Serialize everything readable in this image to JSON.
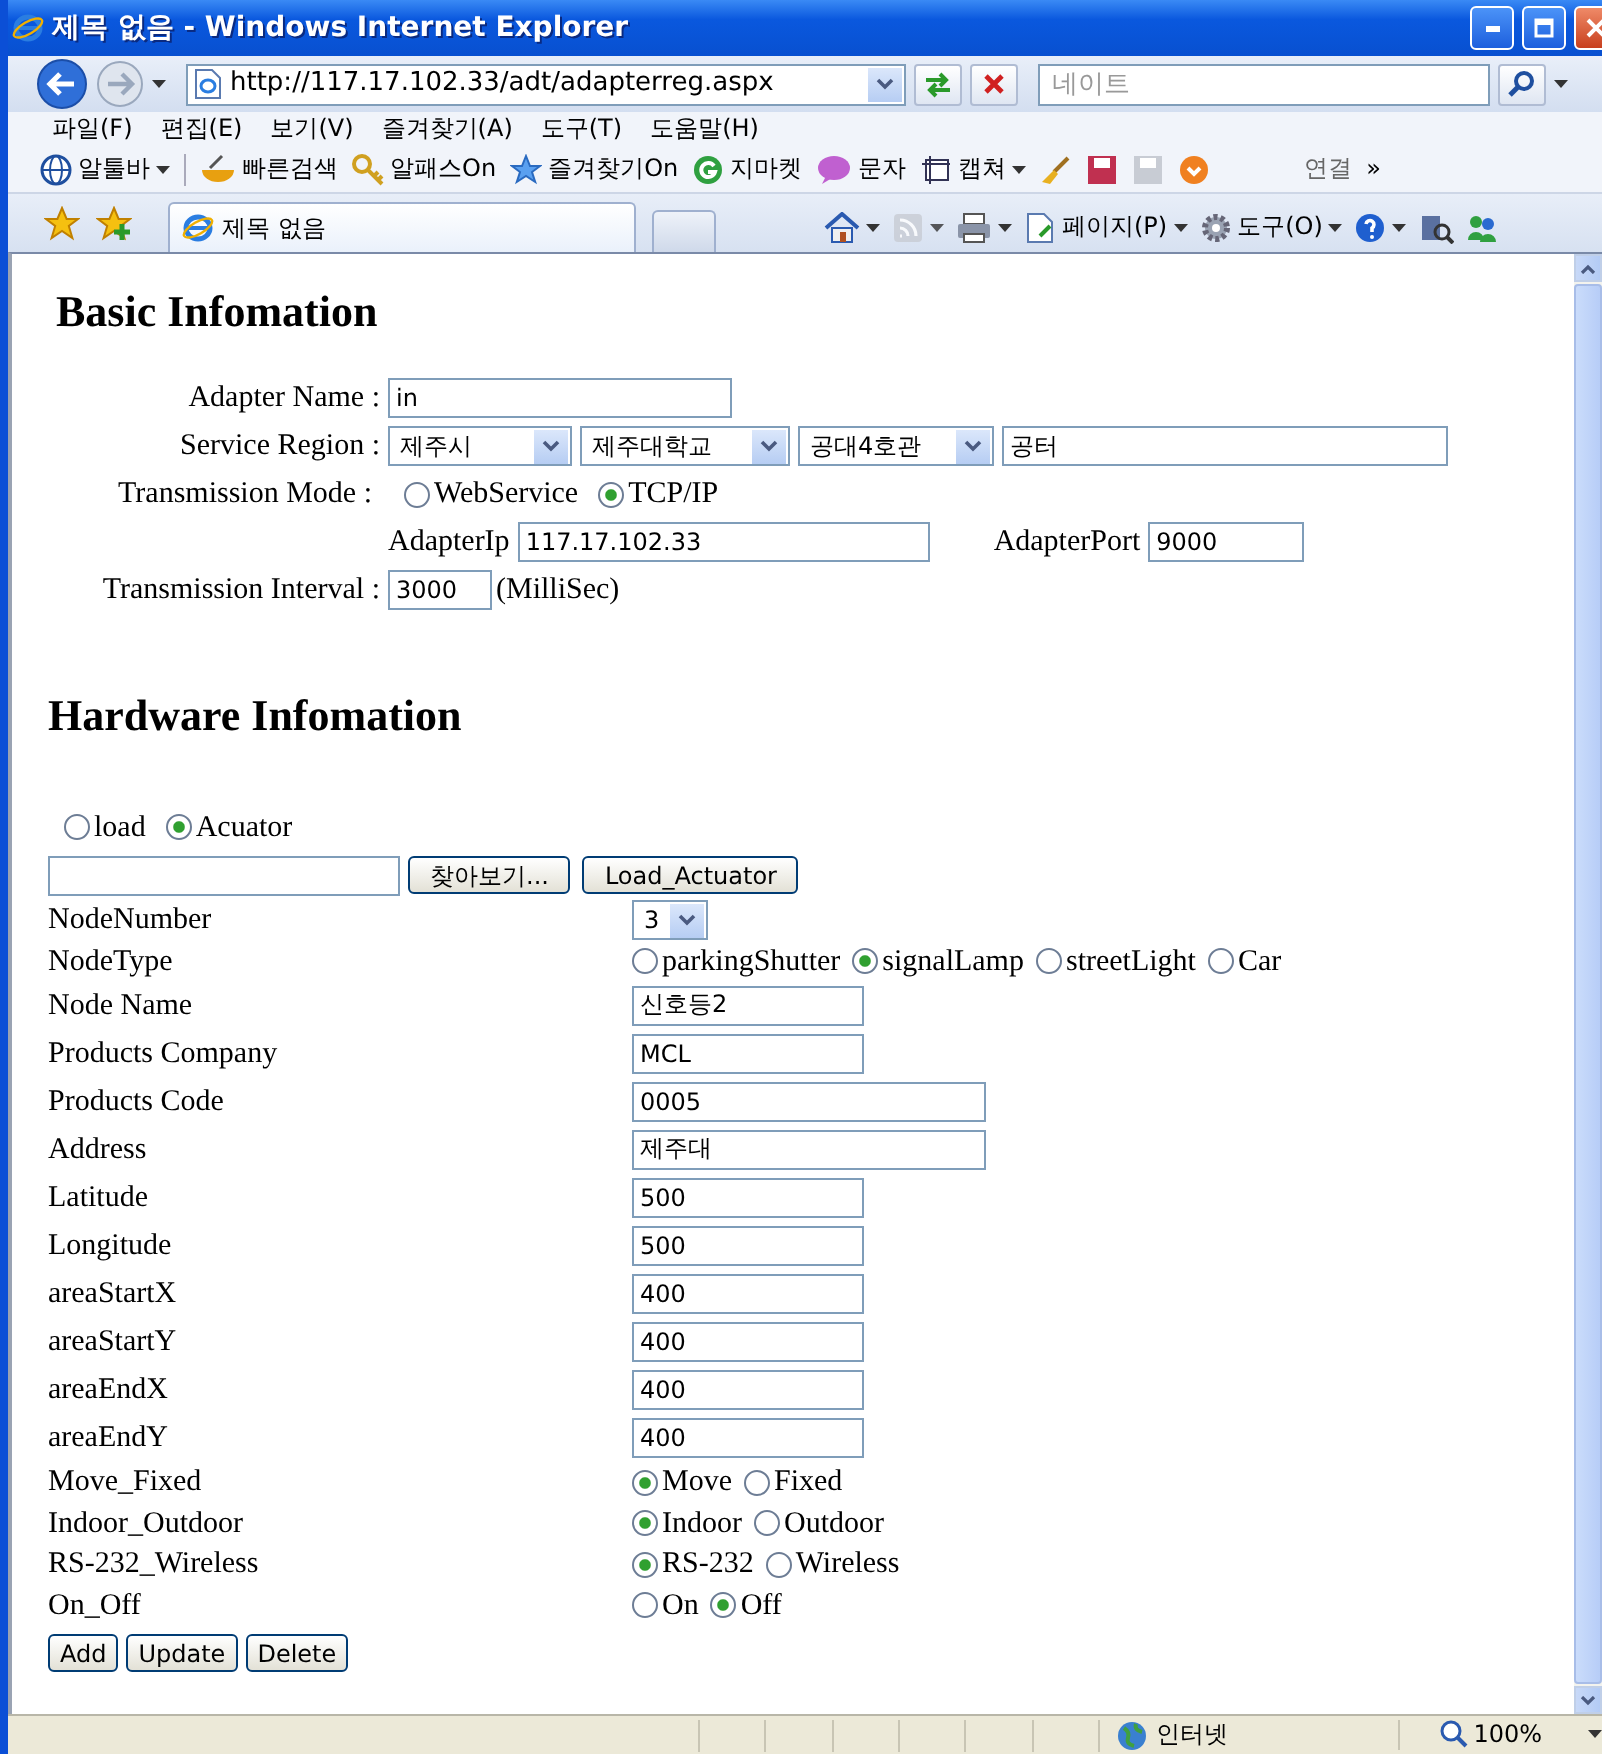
{
  "window": {
    "title": "제목 없음 - Windows Internet Explorer"
  },
  "address_bar": {
    "url": "http://117.17.102.33/adt/adapterreg.aspx",
    "search_placeholder": "네이트"
  },
  "menu": [
    "파일(F)",
    "편집(E)",
    "보기(V)",
    "즐겨찾기(A)",
    "도구(T)",
    "도움말(H)"
  ],
  "links_toolbar": {
    "items": [
      {
        "label": "알툴바",
        "menu": true
      },
      {
        "label": "빠른검색",
        "menu": false
      },
      {
        "label": "알패스On",
        "menu": false
      },
      {
        "label": "즐겨찾기On",
        "menu": false
      },
      {
        "label": "지마켓",
        "menu": false
      },
      {
        "label": "문자",
        "menu": false
      },
      {
        "label": "캡쳐",
        "menu": true
      }
    ],
    "links": "연결",
    "more": "»"
  },
  "tab": {
    "title": "제목 없음",
    "selected": true
  },
  "command_bar": {
    "menus": [
      "페이지(P)",
      "도구(O)"
    ]
  },
  "basic": {
    "heading": "Basic Infomation",
    "adapter_name": {
      "label": "Adapter Name :",
      "value": "in"
    },
    "service_region": {
      "label": "Service Region :",
      "selects": [
        "제주시",
        "제주대학교",
        "공대4호관"
      ],
      "detail": "공터"
    },
    "transmission_mode": {
      "label": "Transmission Mode :",
      "options": [
        {
          "label": "WebService",
          "selected": false
        },
        {
          "label": "TCP/IP",
          "selected": true
        }
      ]
    },
    "adapter_ip": {
      "label": "AdapterIp",
      "value": "117.17.102.33"
    },
    "adapter_port": {
      "label": "AdapterPort",
      "value": "9000"
    },
    "interval": {
      "label": "Transmission Interval :",
      "value": "3000",
      "unit": "(MilliSec)"
    }
  },
  "hardware": {
    "heading": "Hardware Infomation",
    "source": [
      {
        "label": "load",
        "selected": false
      },
      {
        "label": "Acuator",
        "selected": true
      }
    ],
    "browse_button": "찾아보기...",
    "load_button": "Load_Actuator",
    "fields": [
      {
        "kind": "select",
        "label": "NodeNumber",
        "value": "3"
      },
      {
        "kind": "radio",
        "label": "NodeType",
        "options": [
          {
            "label": "parkingShutter",
            "selected": false
          },
          {
            "label": "signalLamp",
            "selected": true
          },
          {
            "label": "streetLight",
            "selected": false
          },
          {
            "label": "Car",
            "selected": false
          }
        ]
      },
      {
        "kind": "text",
        "label": "Node Name",
        "value": "신호등2",
        "wide": false
      },
      {
        "kind": "text",
        "label": "Products Company",
        "value": "MCL",
        "wide": false
      },
      {
        "kind": "text",
        "label": "Products Code",
        "value": "0005",
        "wide": true
      },
      {
        "kind": "text",
        "label": "Address",
        "value": "제주대",
        "wide": true
      },
      {
        "kind": "text",
        "label": "Latitude",
        "value": "500",
        "wide": false
      },
      {
        "kind": "text",
        "label": "Longitude",
        "value": "500",
        "wide": false
      },
      {
        "kind": "text",
        "label": "areaStartX",
        "value": "400",
        "wide": false
      },
      {
        "kind": "text",
        "label": "areaStartY",
        "value": "400",
        "wide": false
      },
      {
        "kind": "text",
        "label": "areaEndX",
        "value": "400",
        "wide": false
      },
      {
        "kind": "text",
        "label": "areaEndY",
        "value": "400",
        "wide": false
      },
      {
        "kind": "radio",
        "label": "Move_Fixed",
        "options": [
          {
            "label": "Move",
            "selected": true
          },
          {
            "label": "Fixed",
            "selected": false
          }
        ]
      },
      {
        "kind": "radio",
        "label": "Indoor_Outdoor",
        "options": [
          {
            "label": "Indoor",
            "selected": true
          },
          {
            "label": "Outdoor",
            "selected": false
          }
        ]
      },
      {
        "kind": "radio",
        "label": "RS-232_Wireless",
        "options": [
          {
            "label": "RS-232",
            "selected": true
          },
          {
            "label": "Wireless",
            "selected": false
          }
        ]
      },
      {
        "kind": "radio",
        "label": "On_Off",
        "options": [
          {
            "label": "On",
            "selected": false
          },
          {
            "label": "Off",
            "selected": true
          }
        ]
      }
    ],
    "buttons": [
      "Add",
      "Update",
      "Delete"
    ]
  },
  "status_bar": {
    "zone": "인터넷",
    "zoom": "100%"
  }
}
